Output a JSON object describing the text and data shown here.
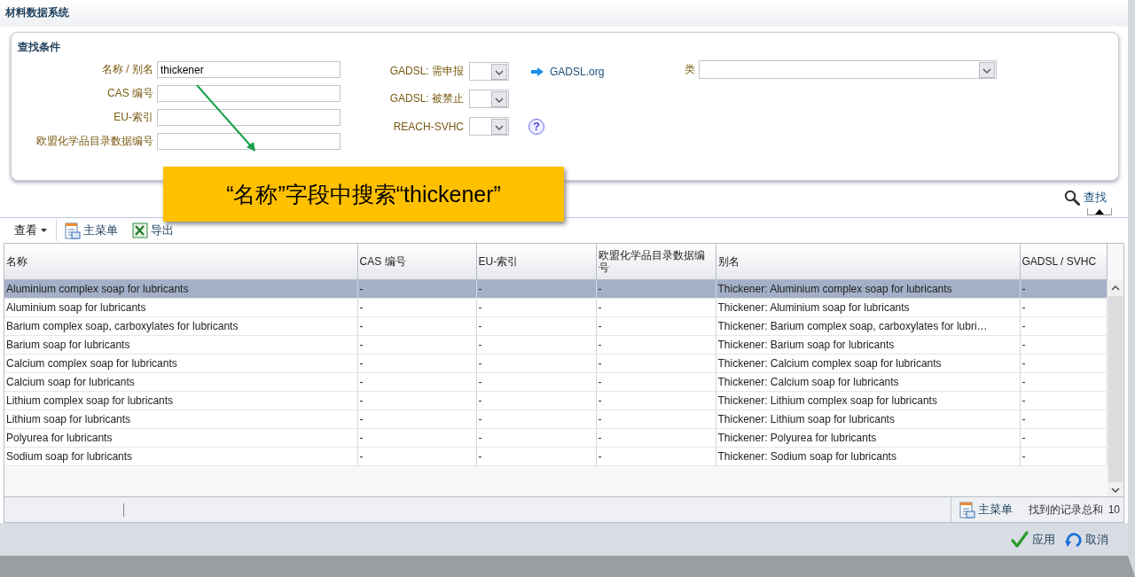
{
  "window": {
    "title": "材料数据系统"
  },
  "search_panel": {
    "title": "查找条件",
    "text_fields": [
      {
        "label": "名称 / 别名",
        "value": "thickener"
      },
      {
        "label": "CAS 编号"
      },
      {
        "label": "EU-索引"
      },
      {
        "label": "欧盟化学品目录数据编号"
      }
    ],
    "help_icon": "?",
    "dropdowns": [
      {
        "label": "GADSL: 需申报"
      },
      {
        "label": "GADSL: 被禁止"
      },
      {
        "label": "REACH-SVHC"
      }
    ],
    "link": "GADSL.org",
    "category_label": "类",
    "search_button": "查找"
  },
  "callout": {
    "text": "“名称”字段中搜索“thickener”"
  },
  "toolbar": {
    "view_menu": "查看",
    "main_menu": "主菜单",
    "export": "导出"
  },
  "table": {
    "columns": [
      "名称",
      "CAS 编号",
      "EU-索引",
      "欧盟化学品目录数据编号",
      "别名",
      "GADSL / SVHC"
    ],
    "rows": [
      {
        "selected": true,
        "cells": [
          "Aluminium complex soap for lubricants",
          "-",
          "-",
          "-",
          "Thickener: Aluminium complex soap for lubricants",
          "-"
        ]
      },
      {
        "selected": false,
        "cells": [
          "Aluminium soap for lubricants",
          "-",
          "-",
          "-",
          "Thickener: Aluminium soap for lubricants",
          "-"
        ]
      },
      {
        "selected": false,
        "cells": [
          "Barium complex soap, carboxylates for lubricants",
          "-",
          "-",
          "-",
          "Thickener: Barium complex soap, carboxylates for lubri…",
          "-"
        ]
      },
      {
        "selected": false,
        "cells": [
          "Barium soap for lubricants",
          "-",
          "-",
          "-",
          "Thickener: Barium soap for lubricants",
          "-"
        ]
      },
      {
        "selected": false,
        "cells": [
          "Calcium complex soap for lubricants",
          "-",
          "-",
          "-",
          "Thickener: Calcium complex soap for lubricants",
          "-"
        ]
      },
      {
        "selected": false,
        "cells": [
          "Calcium soap for lubricants",
          "-",
          "-",
          "-",
          "Thickener: Calcium soap for lubricants",
          "-"
        ]
      },
      {
        "selected": false,
        "cells": [
          "Lithium complex soap for lubricants",
          "-",
          "-",
          "-",
          "Thickener: Lithium complex soap for lubricants",
          "-"
        ]
      },
      {
        "selected": false,
        "cells": [
          "Lithium soap for lubricants",
          "-",
          "-",
          "-",
          "Thickener: Lithium soap for lubricants",
          "-"
        ]
      },
      {
        "selected": false,
        "cells": [
          "Polyurea for lubricants",
          "-",
          "-",
          "-",
          "Thickener: Polyurea for lubricants",
          "-"
        ]
      },
      {
        "selected": false,
        "cells": [
          "Sodium soap for lubricants",
          "-",
          "-",
          "-",
          "Thickener: Sodium soap for lubricants",
          "-"
        ]
      }
    ]
  },
  "footer": {
    "main_menu": "主菜单",
    "count_label": "找到的记录总和",
    "count": "10"
  },
  "buttons": [
    {
      "kind": "apply",
      "label": "应用"
    },
    {
      "kind": "cancel",
      "label": "取消"
    }
  ]
}
